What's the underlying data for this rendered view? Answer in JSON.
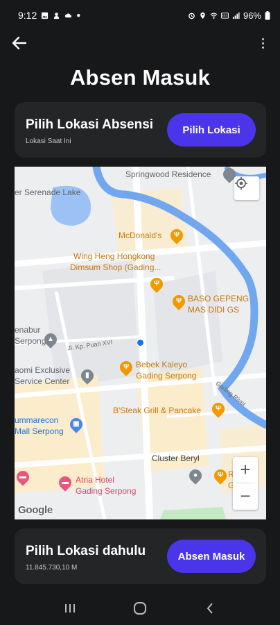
{
  "status_bar": {
    "time": "9:12",
    "battery": "96%"
  },
  "app_bar": {
    "back_icon": "arrow-left-icon",
    "more_icon": "more-vertical-icon"
  },
  "title": "Absen Masuk",
  "location_card": {
    "heading": "Pilih Lokasi Absensi",
    "subtitle": "Lokasi Saat Ini",
    "button_label": "Pilih Lokasi"
  },
  "map": {
    "labels": {
      "springwood": "Springwood Residence",
      "serenade": "er Serenade Lake",
      "mcdonalds": "McDonald's",
      "wingheng_1": "Wing Heng Hongkong",
      "wingheng_2": "Dimsum Shop (Gading...",
      "baso_1": "BASO GEPENG",
      "baso_2": "MAS DIDI GS",
      "enabur_1": "enabur",
      "enabur_2": "Serpong",
      "road_puan": "Jl. Kp. Puan XVI",
      "xiaomi_1": "aomi Exclusive",
      "xiaomi_2": "Service Center",
      "bebek_1": "Bebek Kaleyo",
      "bebek_2": "Gading Serpong",
      "bsteak": "B'Steak Grill & Pancake",
      "summarecon_1": "ummarecon",
      "summarecon_2": "Mall Serpong",
      "cluster_beryl": "Cluster Beryl",
      "atria_1": "Atria Hotel",
      "atria_2": "Gading Serpong",
      "right_1": "Rol",
      "right_2": "Gra",
      "river_road": "Gading River",
      "google": "Google"
    },
    "zoom_in": "+",
    "zoom_out": "−"
  },
  "bottom_card": {
    "heading": "Pilih Lokasi dahulu",
    "subtitle": "11.845.730,10 M",
    "button_label": "Absen Masuk"
  },
  "colors": {
    "background": "#17181a",
    "card": "#232527",
    "accent": "#4a35ea",
    "river": "#71a7ee",
    "user_dot": "#1a73e8"
  }
}
